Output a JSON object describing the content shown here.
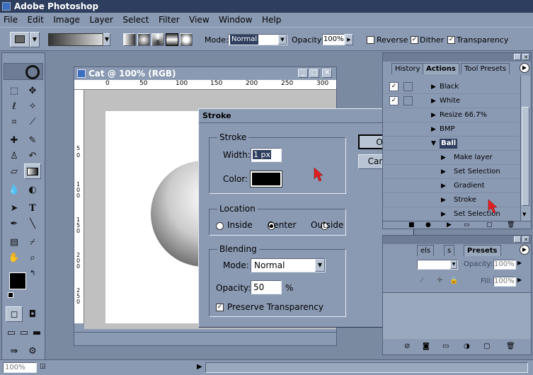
{
  "app": {
    "title": "Adobe Photoshop"
  },
  "menu": [
    "File",
    "Edit",
    "Image",
    "Layer",
    "Select",
    "Filter",
    "View",
    "Window",
    "Help"
  ],
  "options": {
    "mode_label": "Mode:",
    "mode_value": "Normal",
    "opacity_label": "Opacity:",
    "opacity_value": "100%",
    "reverse_label": "Reverse",
    "dither_label": "Dither",
    "transparency_label": "Transparency"
  },
  "document": {
    "title": "Cat @ 100% (RGB)",
    "ruler_top": [
      "0",
      "50",
      "100",
      "150",
      "200",
      "250",
      "300"
    ],
    "ruler_left": [
      "5",
      "0",
      "1 0 0",
      "1 5 0",
      "2 0 0",
      "2 5 0"
    ],
    "zoom": "100%"
  },
  "dialog": {
    "title": "Stroke",
    "stroke_group": "Stroke",
    "width_label": "Width:",
    "width_value": "1 px",
    "color_label": "Color:",
    "location_group": "Location",
    "inside_label": "Inside",
    "center_label": "Center",
    "outside_label": "Outside",
    "blending_group": "Blending",
    "mode_label": "Mode:",
    "mode_value": "Normal",
    "opacity_label": "Opacity:",
    "opacity_value": "50",
    "percent": "%",
    "preserve_label": "Preserve Transparency",
    "ok_label": "OK",
    "cancel_label": "Cancel"
  },
  "panel1": {
    "tabs": [
      "History",
      "Actions",
      "Tool Presets"
    ],
    "actions": [
      {
        "label": "Black",
        "checked": true
      },
      {
        "label": "White",
        "checked": true
      },
      {
        "label": "Resize 66.7%",
        "checked": false
      },
      {
        "label": "BMP",
        "checked": false
      },
      {
        "label": "Ball",
        "checked": false,
        "selected": true
      }
    ],
    "steps": [
      "Make layer",
      "Set Selection",
      "Gradient",
      "Stroke",
      "Set Selection"
    ]
  },
  "panel2": {
    "tabs": [
      "els",
      "s",
      "Presets"
    ],
    "opacity_label": "Opacity:",
    "opacity_value": "100%",
    "fill_label": "Fill:",
    "fill_value": "100%"
  },
  "colors": {
    "accent": "#2e3e5e",
    "panel": "#8b9ab3",
    "selected": "#3b5a8c",
    "arrow": "#e02020"
  }
}
